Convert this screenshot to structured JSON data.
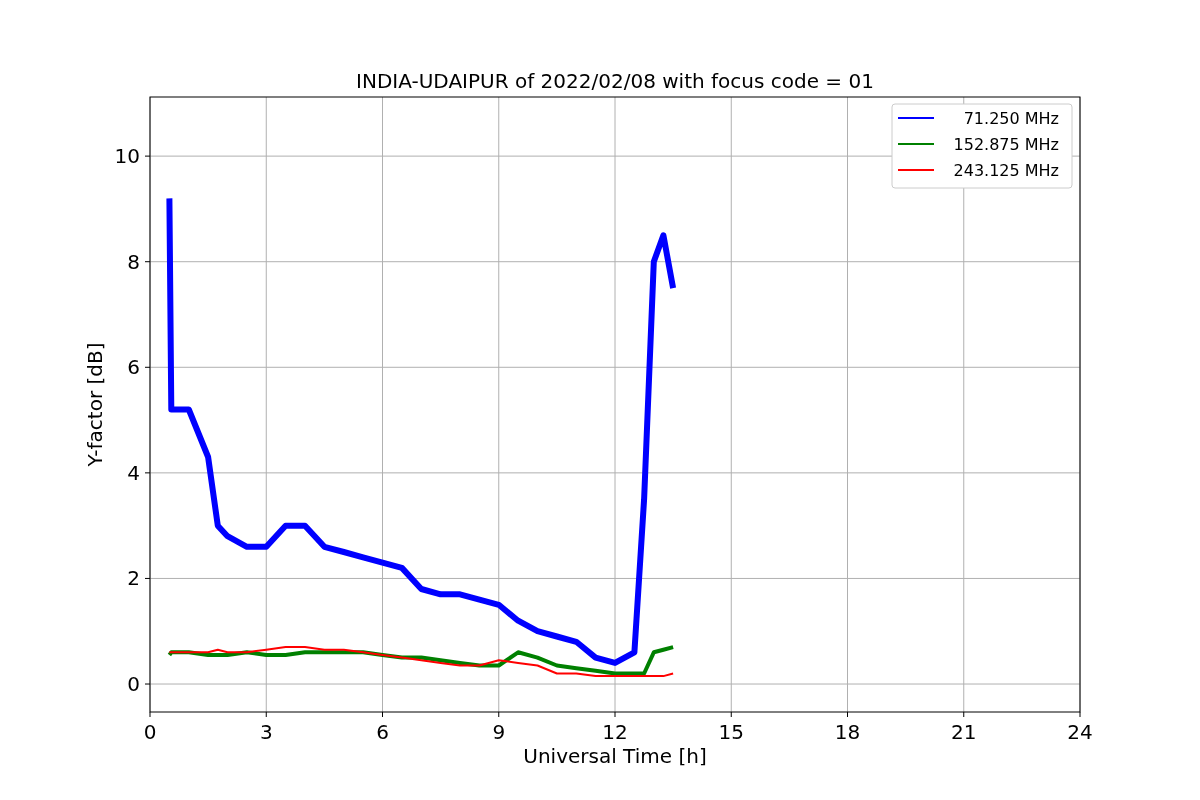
{
  "chart_data": {
    "type": "line",
    "title": "INDIA-UDAIPUR of 2022/02/08 with focus code = 01",
    "xlabel": "Universal Time [h]",
    "ylabel": "Y-factor [dB]",
    "x": [
      0.5,
      0.55,
      1,
      1.5,
      1.75,
      2,
      2.5,
      3,
      3.5,
      4,
      4.5,
      5,
      5.5,
      6,
      6.5,
      7,
      7.5,
      8,
      8.5,
      9,
      9.5,
      10,
      10.5,
      11,
      11.5,
      12,
      12.5,
      12.75,
      13,
      13.25,
      13.5
    ],
    "series": [
      {
        "name": "71.250 MHz",
        "color": "#0000ff",
        "values": [
          9.2,
          5.2,
          5.2,
          4.3,
          3.0,
          2.8,
          2.6,
          2.6,
          3.0,
          3.0,
          2.6,
          2.5,
          2.4,
          2.3,
          2.2,
          1.8,
          1.7,
          1.7,
          1.6,
          1.5,
          1.2,
          1.0,
          0.9,
          0.8,
          0.5,
          0.4,
          0.6,
          3.5,
          8.0,
          8.5,
          7.5
        ]
      },
      {
        "name": "152.875 MHz",
        "color": "#008000",
        "values": [
          0.55,
          0.6,
          0.6,
          0.55,
          0.55,
          0.55,
          0.6,
          0.55,
          0.55,
          0.6,
          0.6,
          0.6,
          0.6,
          0.55,
          0.5,
          0.5,
          0.45,
          0.4,
          0.35,
          0.35,
          0.6,
          0.5,
          0.35,
          0.3,
          0.25,
          0.2,
          0.2,
          0.2,
          0.6,
          0.65,
          0.7
        ]
      },
      {
        "name": "243.125 MHz",
        "color": "#ff0000",
        "values": [
          0.6,
          0.6,
          0.6,
          0.6,
          0.65,
          0.6,
          0.6,
          0.65,
          0.7,
          0.7,
          0.65,
          0.65,
          0.6,
          0.55,
          0.5,
          0.45,
          0.4,
          0.35,
          0.35,
          0.45,
          0.4,
          0.35,
          0.2,
          0.2,
          0.15,
          0.15,
          0.15,
          0.15,
          0.15,
          0.15,
          0.2
        ]
      }
    ],
    "xlim": [
      0,
      24
    ],
    "ylim": [
      -0.53,
      11.12
    ],
    "xticks": [
      0,
      3,
      6,
      9,
      12,
      15,
      18,
      21,
      24
    ],
    "yticks": [
      0,
      2,
      4,
      6,
      8,
      10
    ],
    "grid": true,
    "legend": true
  }
}
